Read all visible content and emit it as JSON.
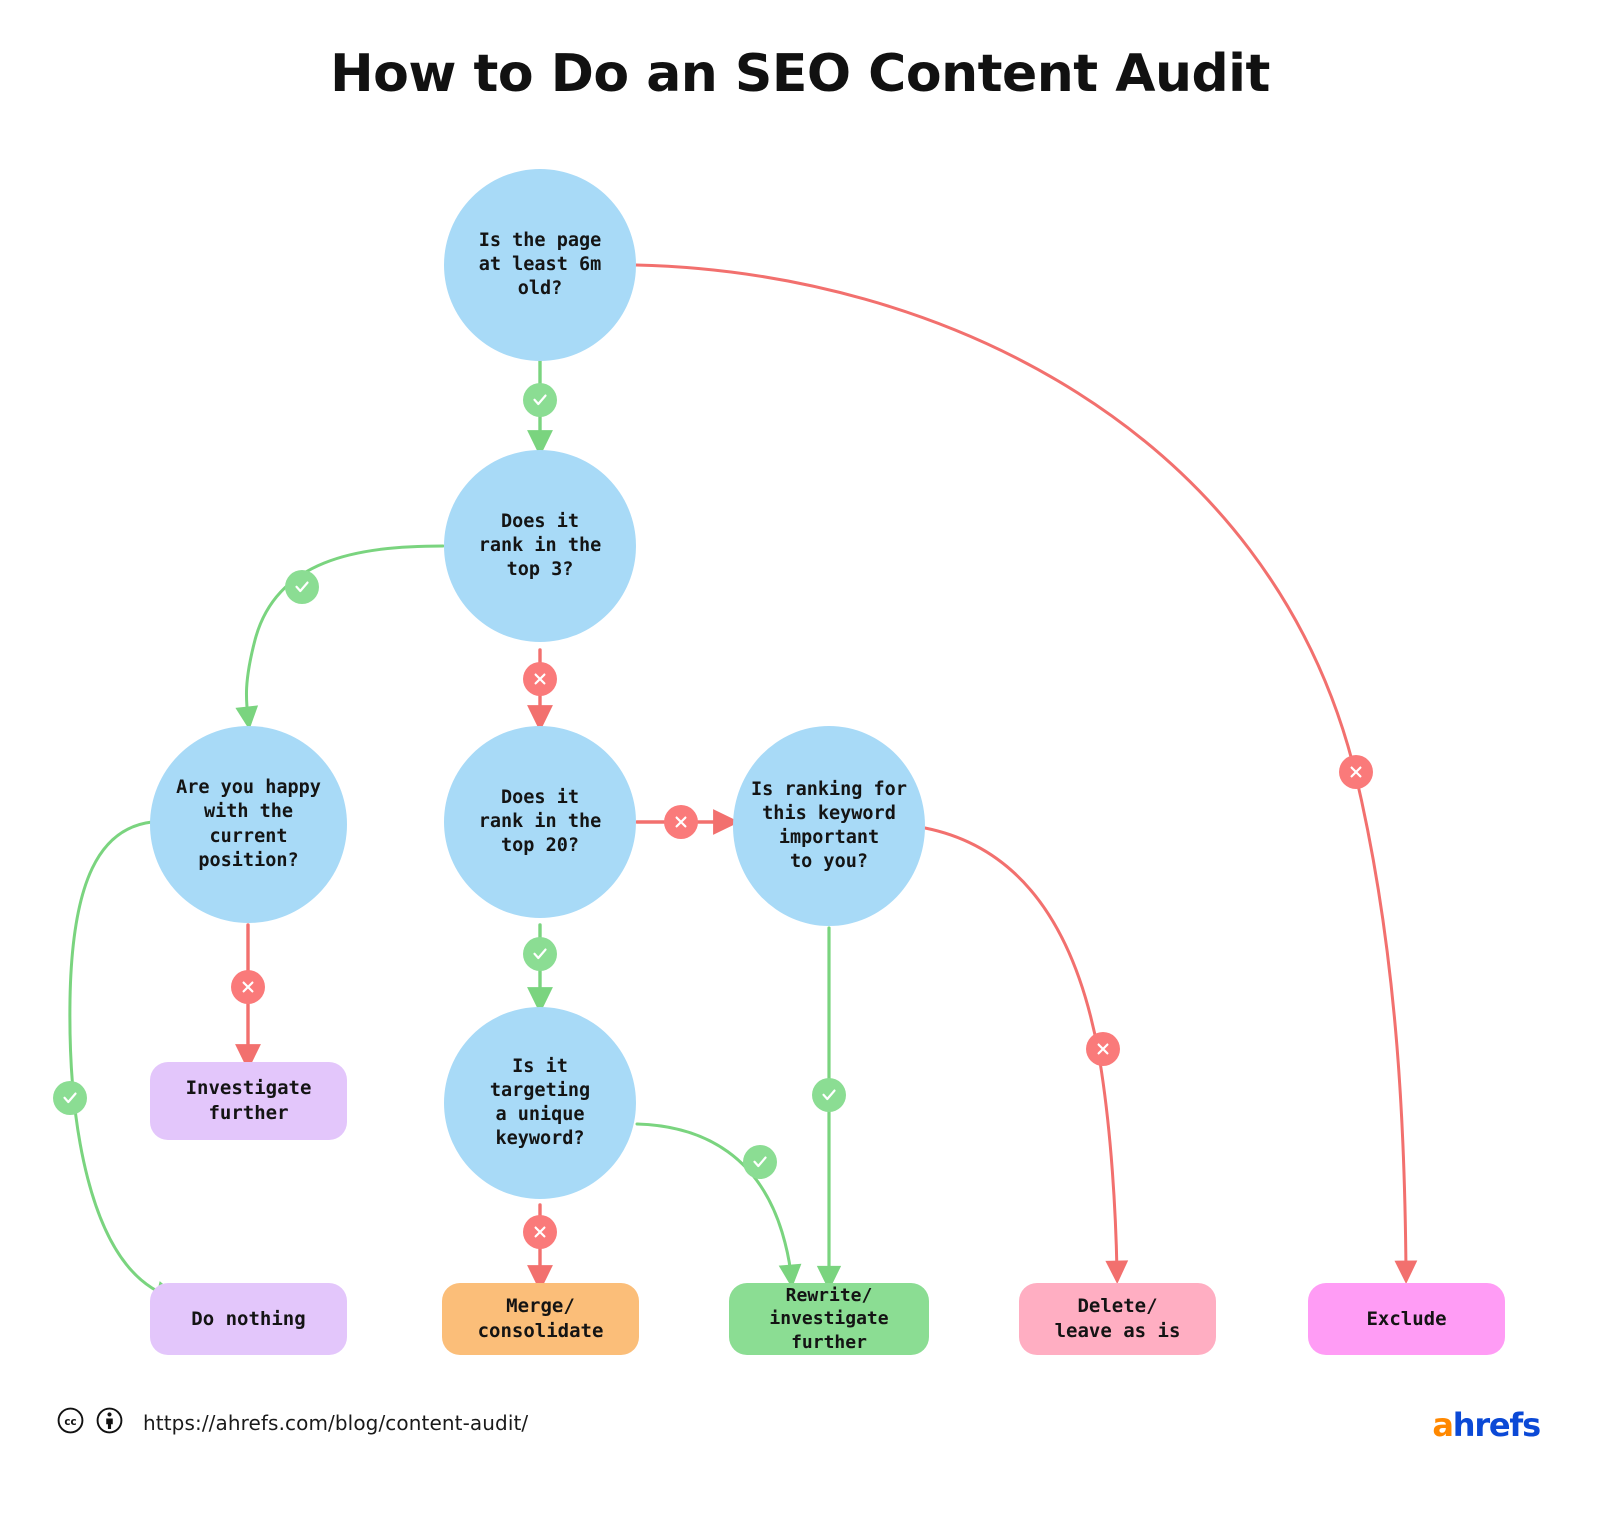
{
  "title": "How to Do an SEO Content Audit",
  "colors": {
    "decision_fill": "#a8daf7",
    "yes_badge": "#8bdd93",
    "no_badge": "#fa7a7a",
    "yes_edge": "#7ad47f",
    "no_edge": "#f2706e",
    "investigate_fill": "#e3c6fb",
    "do_nothing_fill": "#e3c6fb",
    "merge_fill": "#fbbe79",
    "rewrite_fill": "#8bdd93",
    "delete_fill": "#ffaec2",
    "exclude_fill": "#ff9cf5",
    "logo_a": "#ff8800",
    "logo_text": "#0b49d6"
  },
  "chart_data": {
    "type": "diagram",
    "title": "How to Do an SEO Content Audit",
    "nodes": [
      {
        "id": "age",
        "kind": "decision",
        "label": "Is the page\nat least 6m\nold?"
      },
      {
        "id": "top3",
        "kind": "decision",
        "label": "Does it\nrank in the\ntop 3?"
      },
      {
        "id": "happy",
        "kind": "decision",
        "label": "Are you happy\nwith the current\nposition?"
      },
      {
        "id": "top20",
        "kind": "decision",
        "label": "Does it\nrank in the\ntop 20?"
      },
      {
        "id": "important",
        "kind": "decision",
        "label": "Is ranking for\nthis keyword\nimportant\nto you?"
      },
      {
        "id": "unique",
        "kind": "decision",
        "label": "Is it targeting\na unique\nkeyword?"
      },
      {
        "id": "investigate",
        "kind": "terminal",
        "label": "Investigate\nfurther"
      },
      {
        "id": "donothing",
        "kind": "terminal",
        "label": "Do nothing"
      },
      {
        "id": "merge",
        "kind": "terminal",
        "label": "Merge/\nconsolidate"
      },
      {
        "id": "rewrite",
        "kind": "terminal",
        "label": "Rewrite/\ninvestigate further"
      },
      {
        "id": "delete",
        "kind": "terminal",
        "label": "Delete/\nleave as is"
      },
      {
        "id": "exclude",
        "kind": "terminal",
        "label": "Exclude"
      }
    ],
    "edges": [
      {
        "from": "age",
        "to": "top3",
        "branch": "yes"
      },
      {
        "from": "age",
        "to": "exclude",
        "branch": "no"
      },
      {
        "from": "top3",
        "to": "happy",
        "branch": "yes"
      },
      {
        "from": "top3",
        "to": "top20",
        "branch": "no"
      },
      {
        "from": "happy",
        "to": "donothing",
        "branch": "yes"
      },
      {
        "from": "happy",
        "to": "investigate",
        "branch": "no"
      },
      {
        "from": "top20",
        "to": "unique",
        "branch": "yes"
      },
      {
        "from": "top20",
        "to": "important",
        "branch": "no"
      },
      {
        "from": "unique",
        "to": "rewrite",
        "branch": "yes"
      },
      {
        "from": "unique",
        "to": "merge",
        "branch": "no"
      },
      {
        "from": "important",
        "to": "rewrite",
        "branch": "yes"
      },
      {
        "from": "important",
        "to": "delete",
        "branch": "no"
      }
    ]
  },
  "nodes": {
    "age": "Is the page\nat least 6m\nold?",
    "top3": "Does it\nrank in the\ntop 3?",
    "happy": "Are you happy\nwith the current\nposition?",
    "top20": "Does it\nrank in the\ntop 20?",
    "important": "Is ranking for\nthis keyword\nimportant\nto you?",
    "unique": "Is it targeting\na unique\nkeyword?",
    "investigate": "Investigate\nfurther",
    "donothing": "Do nothing",
    "merge": "Merge/\nconsolidate",
    "rewrite": "Rewrite/\ninvestigate further",
    "delete": "Delete/\nleave as is",
    "exclude": "Exclude"
  },
  "footer": {
    "url": "https://ahrefs.com/blog/content-audit/",
    "license_icons": [
      "creative-commons-icon",
      "creative-commons-by-icon"
    ],
    "logo_a": "a",
    "logo_rest": "hrefs"
  }
}
